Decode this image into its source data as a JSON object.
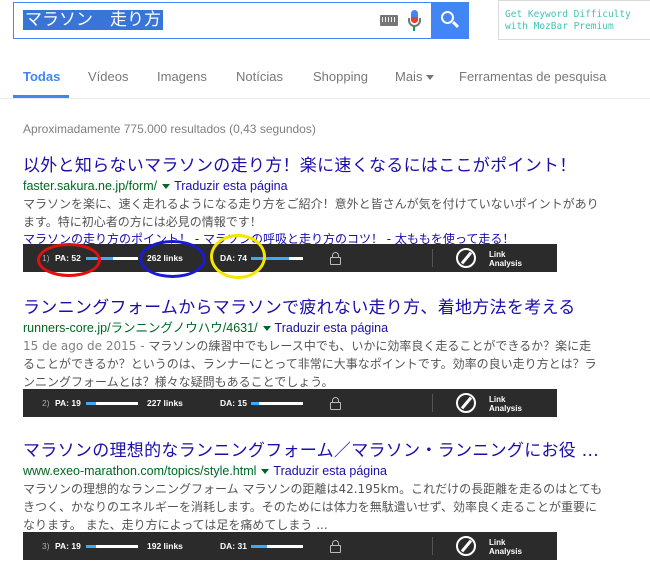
{
  "search": {
    "query": "マラソン　走り方",
    "keyboard_icon": "keyboard-icon",
    "mic_icon": "mic-icon",
    "search_icon": "search-icon"
  },
  "moz_promo": {
    "line1": "Get Keyword Difficulty",
    "line2": "with MozBar Premium"
  },
  "tabs": [
    {
      "label": "Todas",
      "active": true
    },
    {
      "label": "Vídeos"
    },
    {
      "label": "Imagens"
    },
    {
      "label": "Notícias"
    },
    {
      "label": "Shopping"
    },
    {
      "label": "Mais"
    },
    {
      "label": "Ferramentas de pesquisa"
    }
  ],
  "result_stats": "Aproximadamente 775.000 resultados (0,43 segundos)",
  "results": [
    {
      "title": "以外と知らないマラソンの走り方！楽に速くなるにはここがポイント！",
      "url": "faster.sakura.ne.jp/form/",
      "translate": "Traduzir esta página",
      "snippet": "マラソンを楽に、速く走れるようになる走り方をご紹介！意外と皆さんが気を付けていないポイントがあります。特に初心者の方には必見の情報です！",
      "sitelinks": "マラソンの走り方のポイント！ - マラソンの呼吸と走り方のコツ！ - 太ももを使って走る！",
      "moz": {
        "num": "1)",
        "pa": "PA: 52",
        "pa_value": 52,
        "links": "262 links",
        "da": "DA: 74",
        "da_value": 74,
        "analysis": "Link Analysis"
      }
    },
    {
      "title": "ランニングフォームからマラソンで疲れない走り方、着地方法を考える",
      "url": "runners-core.jp/ランニングノウハウ/4631/",
      "translate": "Traduzir esta página",
      "date": "15 de ago de 2015 - ",
      "snippet": "マラソンの練習中でもレース中でも、いかに効率良く走ることができるか？楽に走ることができるか？というのは、ランナーにとって非常に大事なポイントです。効率の良い走り方とは？ランニングフォームとは？様々な疑問もあることでしょう。",
      "moz": {
        "num": "2)",
        "pa": "PA: 19",
        "pa_value": 19,
        "links": "227 links",
        "da": "DA: 15",
        "da_value": 15,
        "analysis": "Link Analysis"
      }
    },
    {
      "title": "マラソンの理想的なランニングフォーム／マラソン・ランニングにお役 ...",
      "url": "www.exeo-marathon.com/topics/style.html",
      "translate": "Traduzir esta página",
      "snippet": "マラソンの理想的なランニングフォーム マラソンの距離は42.195km。これだけの長距離を走るのはとてもきつく、かなりのエネルギーを消耗します。そのためには体力を無駄遣いせず、効率良く走ることが重要になります。 また、走り方によっては足を痛めてしまう ...",
      "moz": {
        "num": "3)",
        "pa": "PA: 19",
        "pa_value": 19,
        "links": "192 links",
        "da": "DA: 31",
        "da_value": 31,
        "analysis": "Link Analysis"
      }
    }
  ],
  "colors": {
    "accent": "#4285f4",
    "title_link": "#1a0dab",
    "url": "#006621",
    "highlight_red": "#e01010",
    "highlight_blue": "#1a1ad6",
    "highlight_yellow": "#f5e600"
  }
}
